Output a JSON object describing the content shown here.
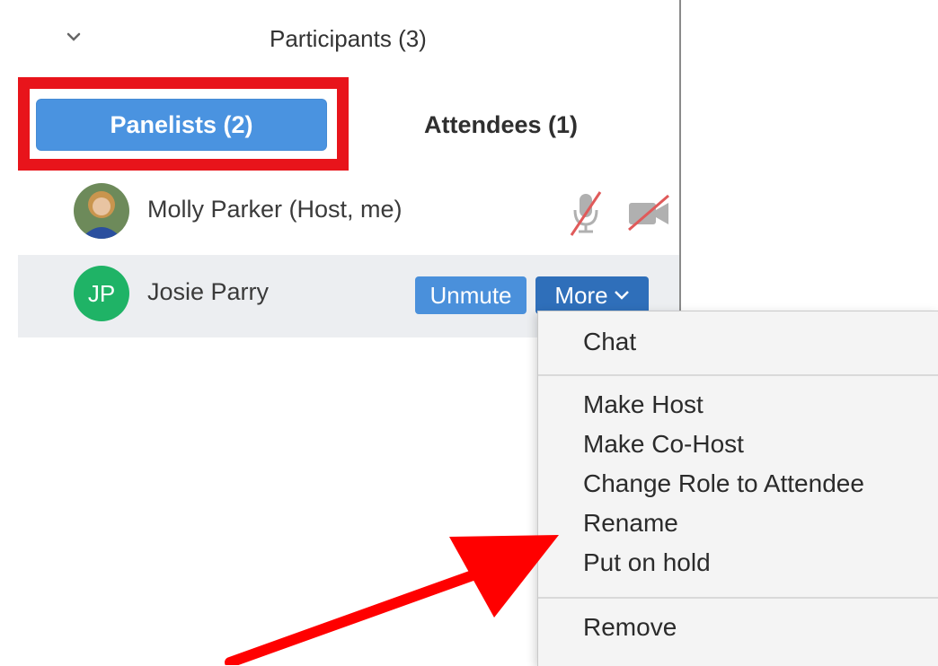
{
  "header": {
    "title": "Participants (3)",
    "collapse_icon": "chevron-down-icon"
  },
  "tabs": {
    "panelists": "Panelists (2)",
    "attendees": "Attendees (1)"
  },
  "participants": [
    {
      "name": "Molly Parker (Host, me)",
      "mic": "muted",
      "video": "off"
    },
    {
      "name": "Josie Parry",
      "initials": "JP",
      "unmute_label": "Unmute",
      "more_label": "More"
    }
  ],
  "more_menu": {
    "items": [
      "Chat",
      "Make Host",
      "Make Co-Host",
      "Change Role to Attendee",
      "Rename",
      "Put on hold",
      "Remove"
    ]
  },
  "colors": {
    "accent": "#4a93e0",
    "more_button": "#2f6fba",
    "highlight": "#e8141b",
    "avatar_jp": "#1fb366"
  }
}
